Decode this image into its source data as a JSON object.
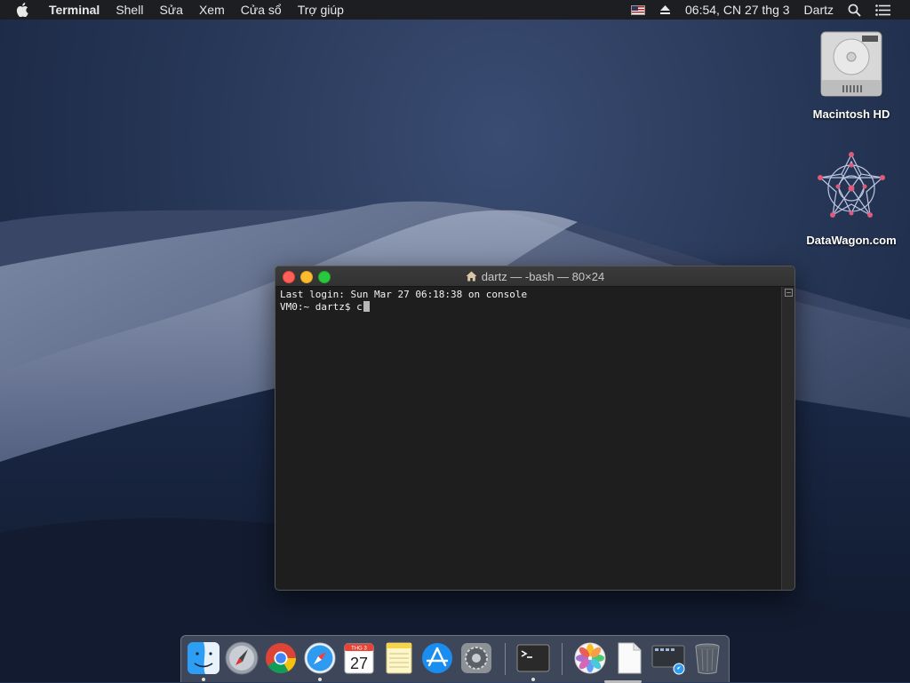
{
  "menubar": {
    "app_name": "Terminal",
    "menus": [
      "Shell",
      "Sửa",
      "Xem",
      "Cửa sổ",
      "Trợ giúp"
    ],
    "clock": "06:54, CN 27 thg 3",
    "user": "Dartz"
  },
  "desktop": {
    "icons": [
      {
        "label": "Macintosh HD",
        "icon": "hard-drive-icon"
      },
      {
        "label": "DataWagon.com",
        "icon": "network-mandala-icon"
      }
    ]
  },
  "terminal": {
    "title": "dartz — -bash — 80×24",
    "lines": [
      "Last login: Sun Mar 27 06:18:38 on console",
      "VM0:~ dartz$ c"
    ]
  },
  "dock": {
    "calendar": {
      "month": "THG 3",
      "day": "27"
    },
    "apps": [
      "finder-icon",
      "launchpad-icon",
      "chrome-icon",
      "safari-icon",
      "calendar-icon",
      "notes-icon",
      "app-store-icon",
      "system-preferences-icon",
      "terminal-icon",
      "photos-icon",
      "document-icon",
      "screen-sharing-icon",
      "trash-icon"
    ]
  },
  "colors": {
    "close": "#fe5f57",
    "minimize": "#febc2e",
    "maximize": "#28c840",
    "terminal_bg": "#1e1e1e",
    "menubar_bg": "#1c1e22"
  }
}
